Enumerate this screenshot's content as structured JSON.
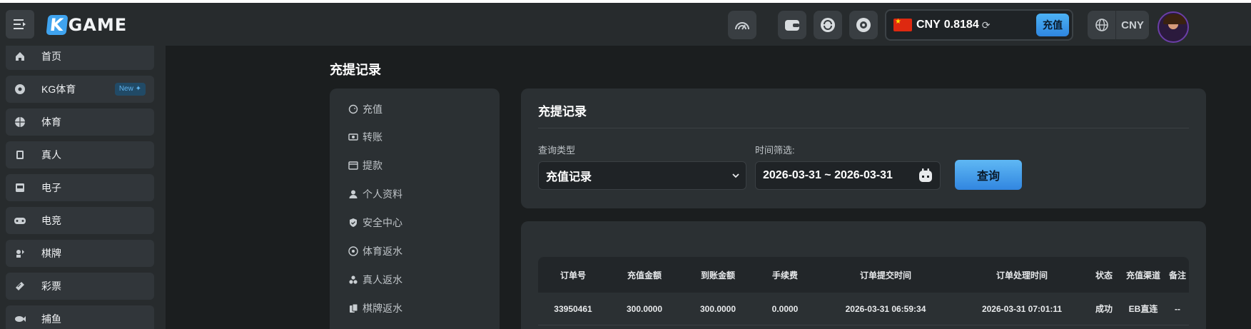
{
  "header": {
    "logo_text": "KGAME",
    "wallet_currency": "CNY",
    "wallet_balance": "0.8184",
    "deposit_label": "充值",
    "currency_label": "CNY"
  },
  "sidebar": {
    "items": [
      {
        "label": "首页",
        "icon": "home-icon"
      },
      {
        "label": "KG体育",
        "icon": "soccer-ball-icon",
        "badge": "New"
      },
      {
        "label": "体育",
        "icon": "basketball-icon"
      },
      {
        "label": "真人",
        "icon": "cards-icon"
      },
      {
        "label": "电子",
        "icon": "slot-machine-icon"
      },
      {
        "label": "电竞",
        "icon": "gamepad-icon"
      },
      {
        "label": "棋牌",
        "icon": "chess-icon"
      },
      {
        "label": "彩票",
        "icon": "lottery-ticket-icon"
      },
      {
        "label": "捕鱼",
        "icon": "fish-icon"
      }
    ]
  },
  "page": {
    "title": "充提记录"
  },
  "user_menu": {
    "items": [
      {
        "label": "充值",
        "icon": "piggy-bank-icon"
      },
      {
        "label": "转账",
        "icon": "transfer-icon"
      },
      {
        "label": "提款",
        "icon": "withdraw-icon"
      },
      {
        "label": "个人资料",
        "icon": "user-icon"
      },
      {
        "label": "安全中心",
        "icon": "shield-icon"
      },
      {
        "label": "体育返水",
        "icon": "soccer-ball-icon"
      },
      {
        "label": "真人返水",
        "icon": "chips-icon"
      },
      {
        "label": "棋牌返水",
        "icon": "cards-icon"
      }
    ]
  },
  "filter": {
    "title": "充提记录",
    "type_label": "查询类型",
    "type_value": "充值记录",
    "time_label": "时间筛选:",
    "date_range": "2026-03-31 ~ 2026-03-31",
    "query_label": "查询"
  },
  "table": {
    "headers": [
      "订单号",
      "充值金额",
      "到账金额",
      "手续费",
      "订单提交时间",
      "订单处理时间",
      "状态",
      "充值渠道",
      "备注"
    ],
    "rows": [
      [
        "33950461",
        "300.0000",
        "300.0000",
        "0.0000",
        "2026-03-31 06:59:34",
        "2026-03-31 07:01:11",
        "成功",
        "EB直连",
        "--"
      ]
    ]
  },
  "colors": {
    "accent": "#3fa3ee",
    "background": "#1b1e1f",
    "panel": "#2b3033"
  }
}
